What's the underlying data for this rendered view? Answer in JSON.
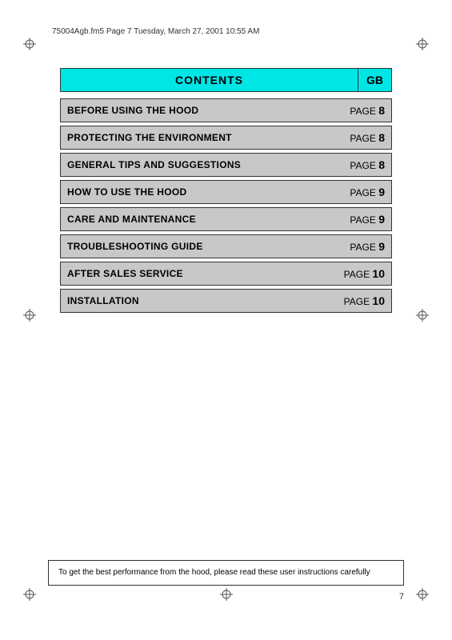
{
  "header": {
    "file_info": "75004Agb.fm5  Page 7  Tuesday, March 27, 2001  10:55 AM"
  },
  "contents": {
    "title": "CONTENTS",
    "gb_label": "GB"
  },
  "toc_items": [
    {
      "label": "BEFORE USING THE HOOD",
      "page_prefix": "PAGE",
      "page_num": "8"
    },
    {
      "label": "PROTECTING THE ENVIRONMENT",
      "page_prefix": "PAGE",
      "page_num": "8"
    },
    {
      "label": "GENERAL TIPS AND SUGGESTIONS",
      "page_prefix": "PAGE",
      "page_num": "8"
    },
    {
      "label": "HOW TO USE THE HOOD",
      "page_prefix": "PAGE",
      "page_num": "9"
    },
    {
      "label": "CARE AND MAINTENANCE",
      "page_prefix": "PAGE",
      "page_num": "9"
    },
    {
      "label": "TROUBLESHOOTING GUIDE",
      "page_prefix": "PAGE",
      "page_num": "9"
    },
    {
      "label": "AFTER SALES SERVICE",
      "page_prefix": "PAGE",
      "page_num": "10"
    },
    {
      "label": "INSTALLATION",
      "page_prefix": "PAGE",
      "page_num": "10"
    }
  ],
  "bottom_note": "To get the best performance from the hood, please read these user instructions carefully",
  "page_number": "7"
}
